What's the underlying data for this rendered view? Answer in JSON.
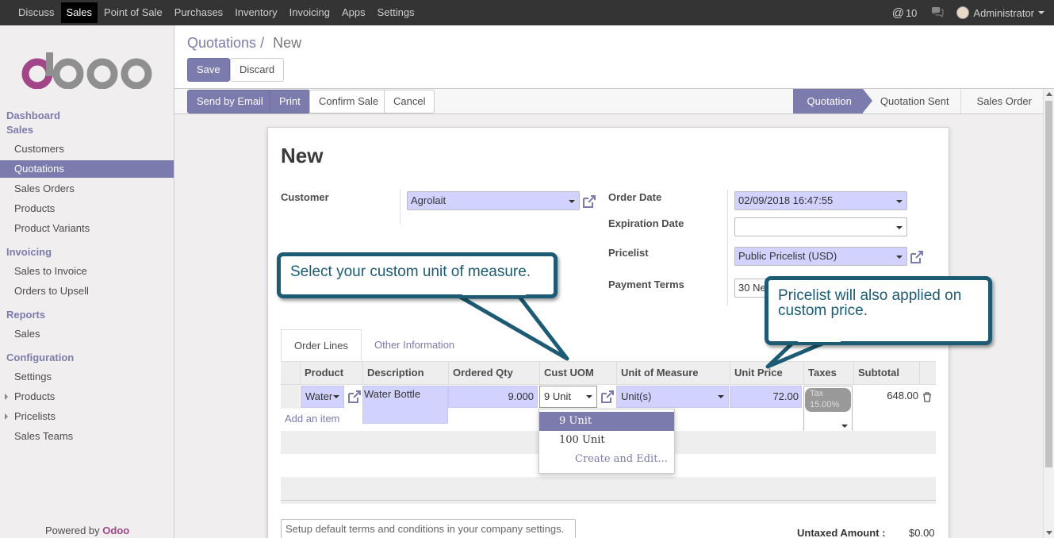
{
  "topbar": {
    "menu": [
      "Discuss",
      "Sales",
      "Point of Sale",
      "Purchases",
      "Inventory",
      "Invoicing",
      "Apps",
      "Settings"
    ],
    "active": "Sales",
    "mentions": "10",
    "user": "Administrator"
  },
  "sidebar": {
    "dashboard": "Dashboard",
    "sales_head": "Sales",
    "sales_items": [
      "Customers",
      "Quotations",
      "Sales Orders",
      "Products",
      "Product Variants"
    ],
    "invoicing_head": "Invoicing",
    "invoicing_items": [
      "Sales to Invoice",
      "Orders to Upsell"
    ],
    "reports_head": "Reports",
    "reports_items": [
      "Sales"
    ],
    "config_head": "Configuration",
    "config_items": [
      "Settings",
      "Products",
      "Pricelists",
      "Sales Teams"
    ],
    "powered_by": "Powered by",
    "powered_brand": "Odoo"
  },
  "breadcrumb": {
    "parent": "Quotations",
    "sep": "/",
    "current": "New"
  },
  "buttons": {
    "save": "Save",
    "discard": "Discard",
    "send_email": "Send by Email",
    "print": "Print",
    "confirm": "Confirm Sale",
    "cancel": "Cancel"
  },
  "stages": [
    "Quotation",
    "Quotation Sent",
    "Sales Order"
  ],
  "form": {
    "title": "New",
    "customer_label": "Customer",
    "customer": "Agrolait",
    "order_date_label": "Order Date",
    "order_date": "02/09/2018 16:47:55",
    "expiration_label": "Expiration Date",
    "expiration": "",
    "pricelist_label": "Pricelist",
    "pricelist": "Public Pricelist (USD)",
    "payment_terms_label": "Payment Terms",
    "payment_terms": "30 Ne"
  },
  "tabs": [
    "Order Lines",
    "Other Information"
  ],
  "table": {
    "headers": [
      "Product",
      "Description",
      "Ordered Qty",
      "Cust UOM",
      "Unit of Measure",
      "Unit Price",
      "Taxes",
      "Subtotal"
    ],
    "row": {
      "product": "Water",
      "description": "Water Bottle",
      "qty": "9.000",
      "cust_uom": "9 Unit",
      "uom": "Unit(s)",
      "unit_price": "72.00",
      "tax": "Tax 15.00%",
      "subtotal": "648.00"
    },
    "add_item": "Add an item"
  },
  "dropdown": {
    "options": [
      "9 Unit",
      "100 Unit"
    ],
    "create": "Create and Edit..."
  },
  "terms_placeholder": "Setup default terms and conditions in your company settings.",
  "totals": {
    "untaxed_label": "Untaxed Amount :",
    "untaxed_value": "$0.00"
  },
  "callouts": {
    "uom": "Select your custom unit of measure.",
    "pricelist": "Pricelist will also applied on custom price."
  },
  "colors": {
    "accent": "#7c7bad",
    "callout": "#1d5b74",
    "topbar": "#343434",
    "required": "#d2d2ff"
  }
}
